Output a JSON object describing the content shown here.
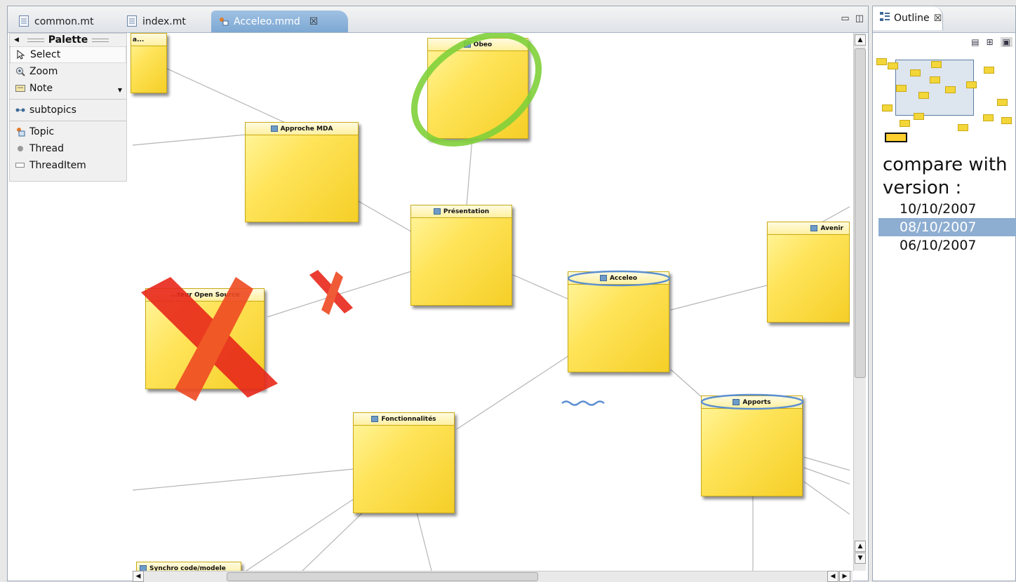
{
  "editor": {
    "tabs": [
      {
        "label": "common.mt",
        "active": false
      },
      {
        "label": "index.mt",
        "active": false
      },
      {
        "label": "Acceleo.mmd",
        "active": true
      }
    ]
  },
  "palette": {
    "title": "Palette",
    "tools": [
      {
        "label": "Select",
        "icon": "arrow-cursor-icon"
      },
      {
        "label": "Zoom",
        "icon": "zoom-icon"
      },
      {
        "label": "Note",
        "icon": "note-icon"
      }
    ],
    "connections": [
      {
        "label": "subtopics",
        "icon": "connection-icon"
      }
    ],
    "nodes": [
      {
        "label": "Topic",
        "icon": "topic-icon"
      },
      {
        "label": "Thread",
        "icon": "thread-icon"
      },
      {
        "label": "ThreadItem",
        "icon": "thread-item-icon"
      }
    ]
  },
  "diagram": {
    "notes": {
      "top_left": "a...",
      "obeo": "Obeo",
      "approche": "Approche MDA",
      "presentation": "Présentation",
      "avenir": "Avenir",
      "open_source": "...teur Open Source",
      "acceleo": "Acceleo",
      "apports": "Apports",
      "fonctionnalites": "Fonctionnalités",
      "synchro": "Synchro code/modele"
    },
    "annotation_colors": {
      "highlight_circle": "#7fd03a",
      "cross": "#e8281a",
      "change_marker": "#5b8fd0"
    }
  },
  "outline": {
    "tab_label": "Outline",
    "compare_label_line1": "compare with",
    "compare_label_line2": "version :",
    "versions": [
      {
        "label": "10/10/2007",
        "selected": false
      },
      {
        "label": "08/10/2007",
        "selected": true
      },
      {
        "label": "06/10/2007",
        "selected": false
      }
    ]
  }
}
